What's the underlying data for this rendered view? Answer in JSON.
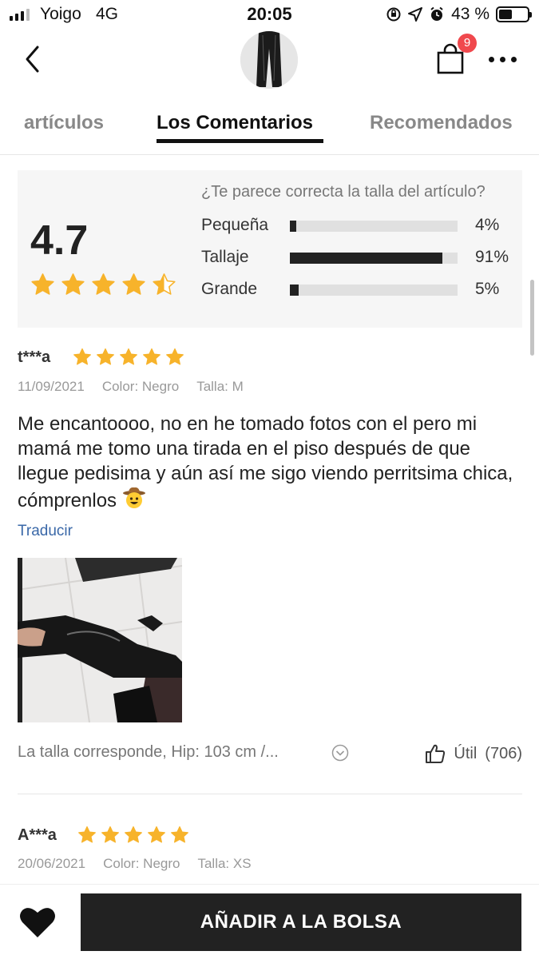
{
  "status_bar": {
    "carrier": "Yoigo",
    "network": "4G",
    "time": "20:05",
    "battery": "43 %",
    "battery_level": 0.43
  },
  "header": {
    "cart_count": "9",
    "icons": [
      "chevron-left-icon",
      "shopping-bag-icon",
      "more-dots-icon"
    ]
  },
  "tabs": [
    {
      "label": "artículos",
      "active": false
    },
    {
      "label": "Los Comentarios",
      "active": true
    },
    {
      "label": "Recomendados",
      "active": false
    }
  ],
  "summary": {
    "score": "4.7",
    "stars": 4.5,
    "fit_question": "¿Te parece correcta la talla del artículo?",
    "fit": [
      {
        "label": "Pequeña",
        "percent": "4%",
        "value": 4
      },
      {
        "label": "Tallaje",
        "percent": "91%",
        "value": 91
      },
      {
        "label": "Grande",
        "percent": "5%",
        "value": 5
      }
    ]
  },
  "reviews": [
    {
      "user": "t***a",
      "stars": 5,
      "date": "11/09/2021",
      "color": "Color: Negro",
      "size": "Talla: M",
      "text": "Me encantoooo, no en he tomado fotos con el pero mi mamá me tomo una tirada en el piso después de que llegue pedisima y aún así me sigo viendo perritsima chica, cómprenlos",
      "translate": "Traducir",
      "fit_info": "La talla corresponde, Hip: 103 cm /...",
      "helpful_label": "Útil",
      "helpful_count": "(706)"
    },
    {
      "user": "A***a",
      "stars": 5,
      "date": "20/06/2021",
      "color": "Color: Negro",
      "size": "Talla: XS"
    }
  ],
  "bottom_bar": {
    "add_to_bag": "AÑADIR A LA BOLSA"
  },
  "colors": {
    "star": "#f7b32b",
    "badge": "#f0484d",
    "link": "#3a68a8",
    "primary_button": "#222222"
  }
}
